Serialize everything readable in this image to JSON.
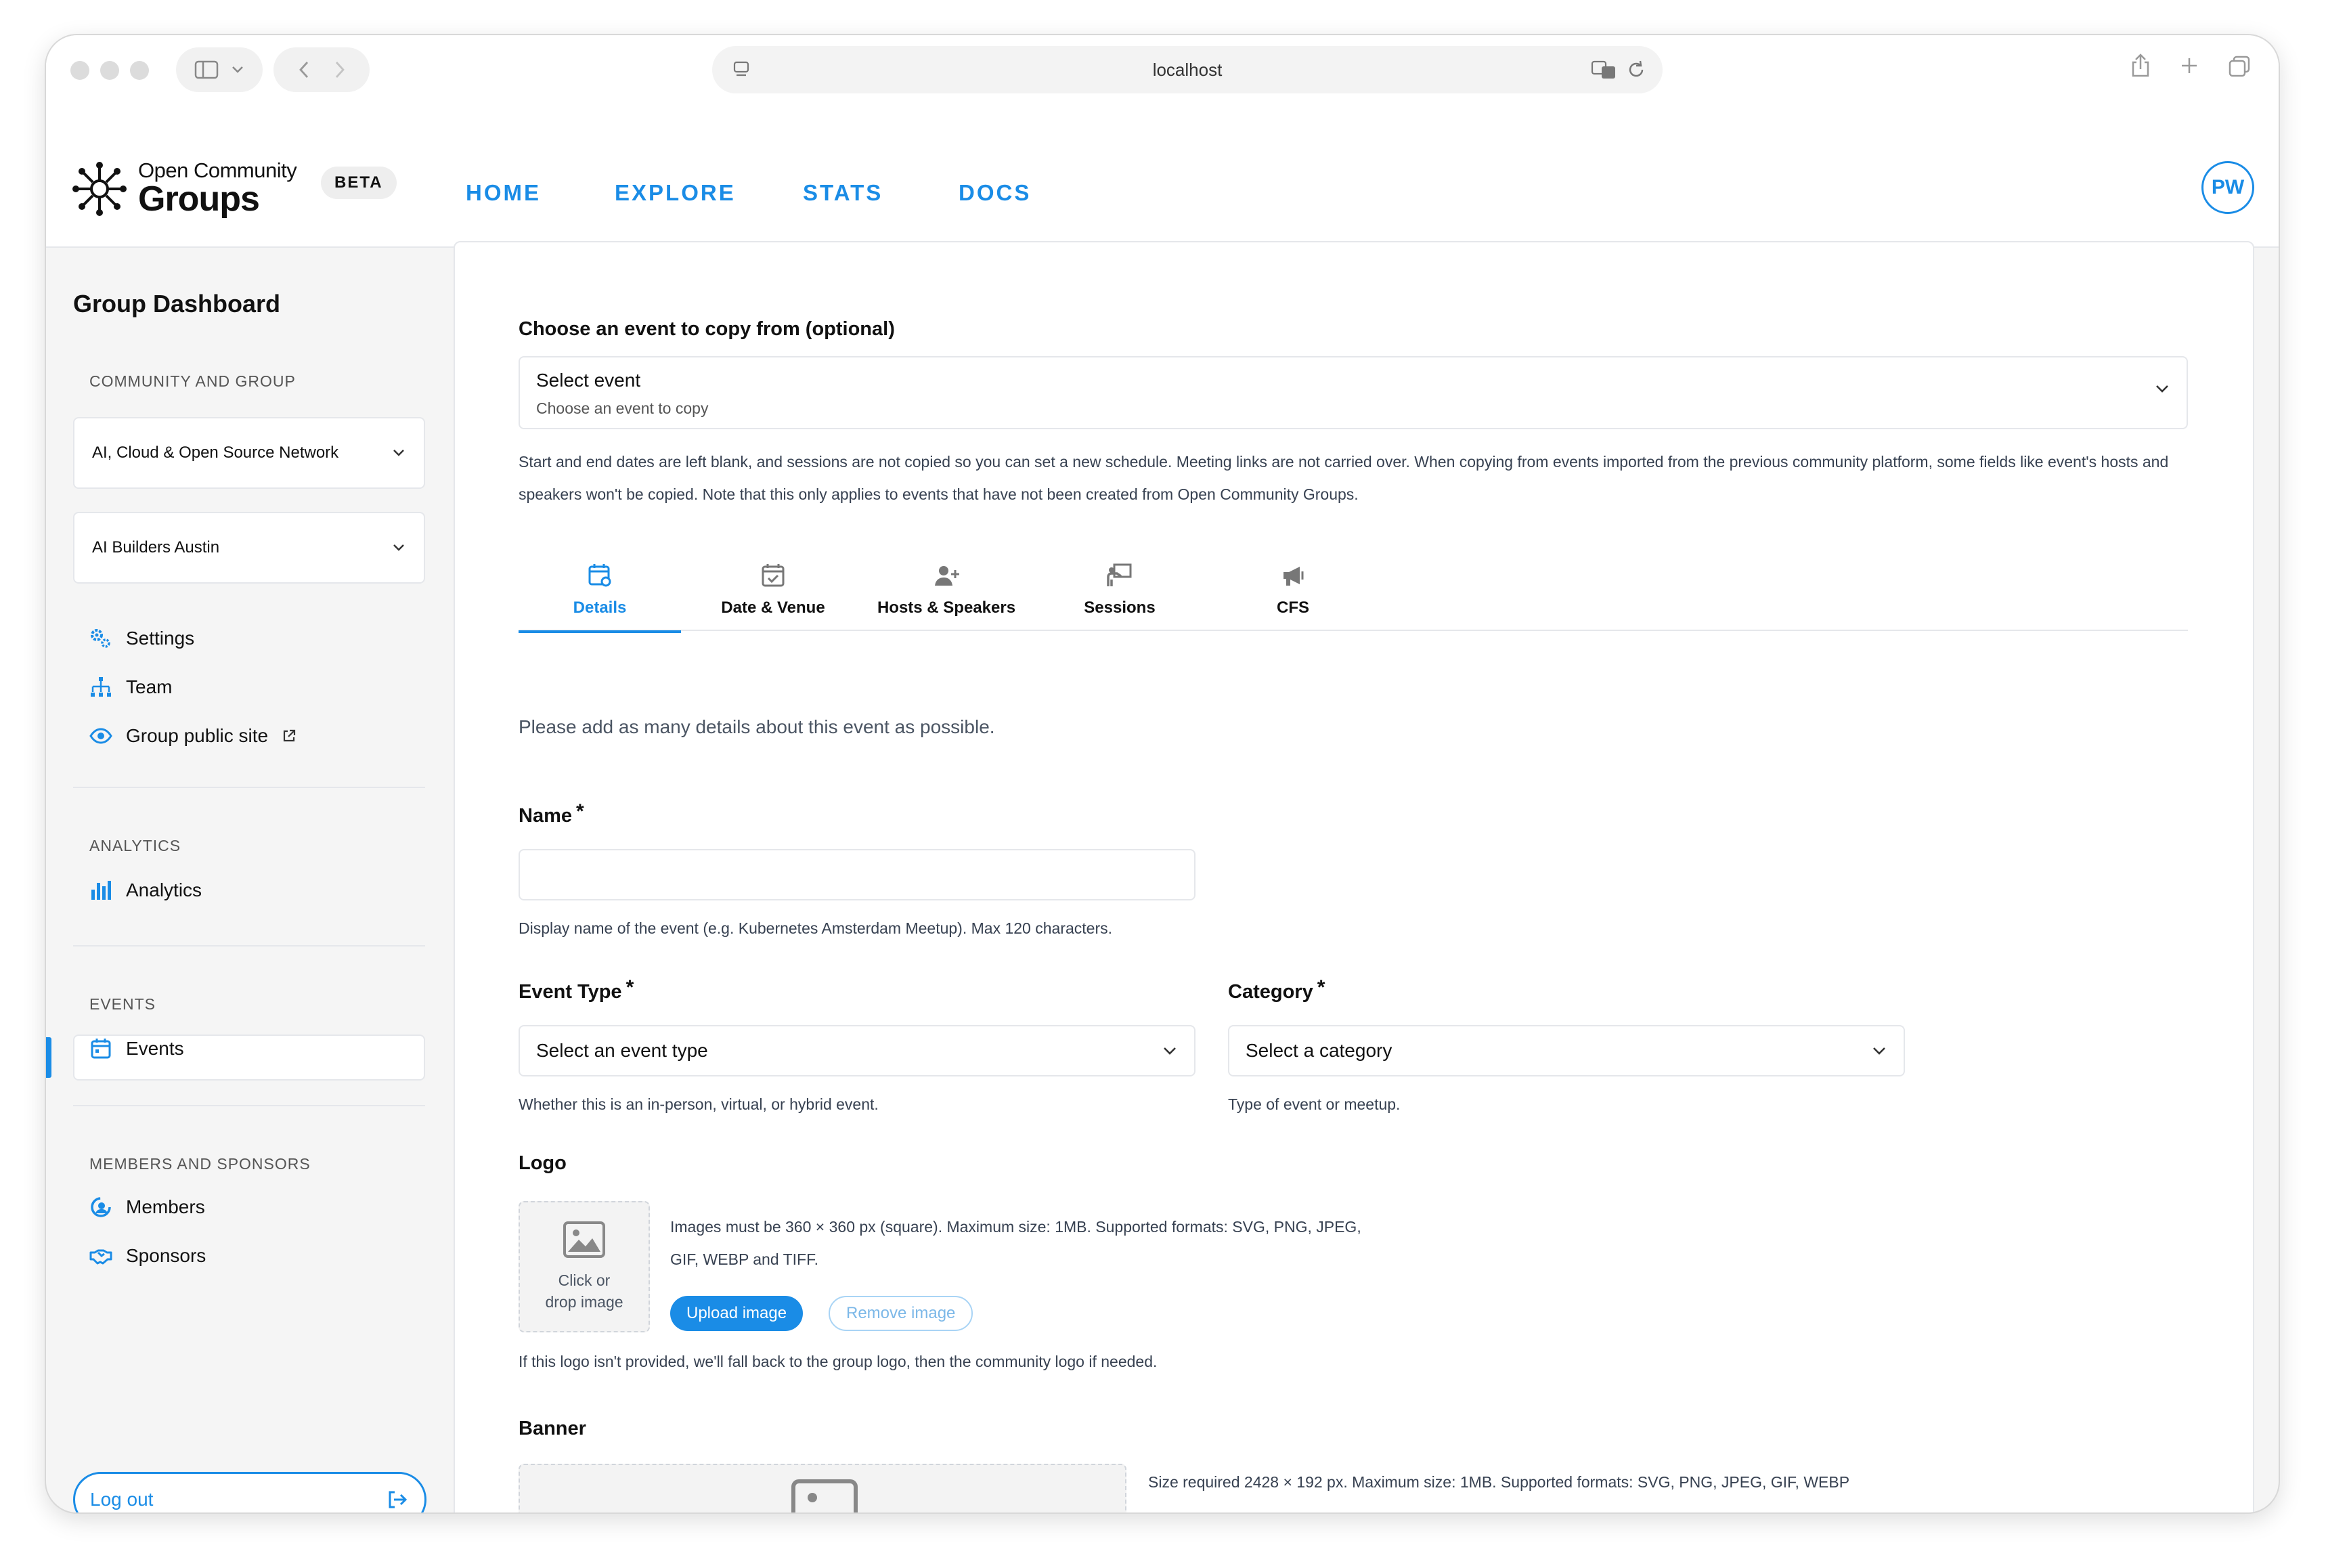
{
  "browser": {
    "url": "localhost"
  },
  "header": {
    "logo_line1": "Open Community",
    "logo_line2": "Groups",
    "beta": "BETA",
    "nav": [
      "HOME",
      "EXPLORE",
      "STATS",
      "DOCS"
    ],
    "avatar_initials": "PW"
  },
  "sidebar": {
    "title": "Group Dashboard",
    "community_section": "COMMUNITY AND GROUP",
    "community_select": "AI, Cloud & Open Source Network",
    "group_select": "AI Builders Austin",
    "links": [
      "Settings",
      "Team",
      "Group public site"
    ],
    "analytics_section": "ANALYTICS",
    "analytics_link": "Analytics",
    "events_section": "EVENTS",
    "events_link": "Events",
    "members_section": "MEMBERS AND SPONSORS",
    "members_link": "Members",
    "sponsors_link": "Sponsors",
    "logout": "Log out"
  },
  "copy": {
    "label": "Choose an event to copy from (optional)",
    "select_title": "Select event",
    "select_sub": "Choose an event to copy",
    "note": "Start and end dates are left blank, and sessions are not copied so you can set a new schedule. Meeting links are not carried over. When copying from events imported from the previous community platform, some fields like event's hosts and speakers won't be copied. Note that this only applies to events that have not been created from Open Community Groups."
  },
  "tabs": [
    "Details",
    "Date & Venue",
    "Hosts & Speakers",
    "Sessions",
    "CFS"
  ],
  "form": {
    "intro": "Please add as many details about this event as possible.",
    "required_mark": "*",
    "name_label": "Name",
    "name_help": "Display name of the event (e.g. Kubernetes Amsterdam Meetup). Max 120 characters.",
    "event_type_label": "Event Type",
    "event_type_value": "Select an event type",
    "event_type_help": "Whether this is an in-person, virtual, or hybrid event.",
    "category_label": "Category",
    "category_value": "Select a category",
    "category_help": "Type of event or meetup.",
    "logo_label": "Logo",
    "logo_drop_1": "Click or",
    "logo_drop_2": "drop image",
    "logo_info_1": "Images must be 360 × 360 px (square). Maximum size: 1MB. Supported formats: SVG, PNG, JPEG,",
    "logo_info_2": "GIF, WEBP and TIFF.",
    "upload_button": "Upload image",
    "remove_button": "Remove image",
    "logo_help": "If this logo isn't provided, we'll fall back to the group logo, then the community logo if needed.",
    "banner_label": "Banner",
    "banner_info": "Size required 2428 × 192 px. Maximum size: 1MB. Supported formats: SVG, PNG, JPEG, GIF, WEBP"
  },
  "colors": {
    "accent": "#1a8ce6",
    "border": "#e5e7eb",
    "background": "#f5f5f5"
  }
}
